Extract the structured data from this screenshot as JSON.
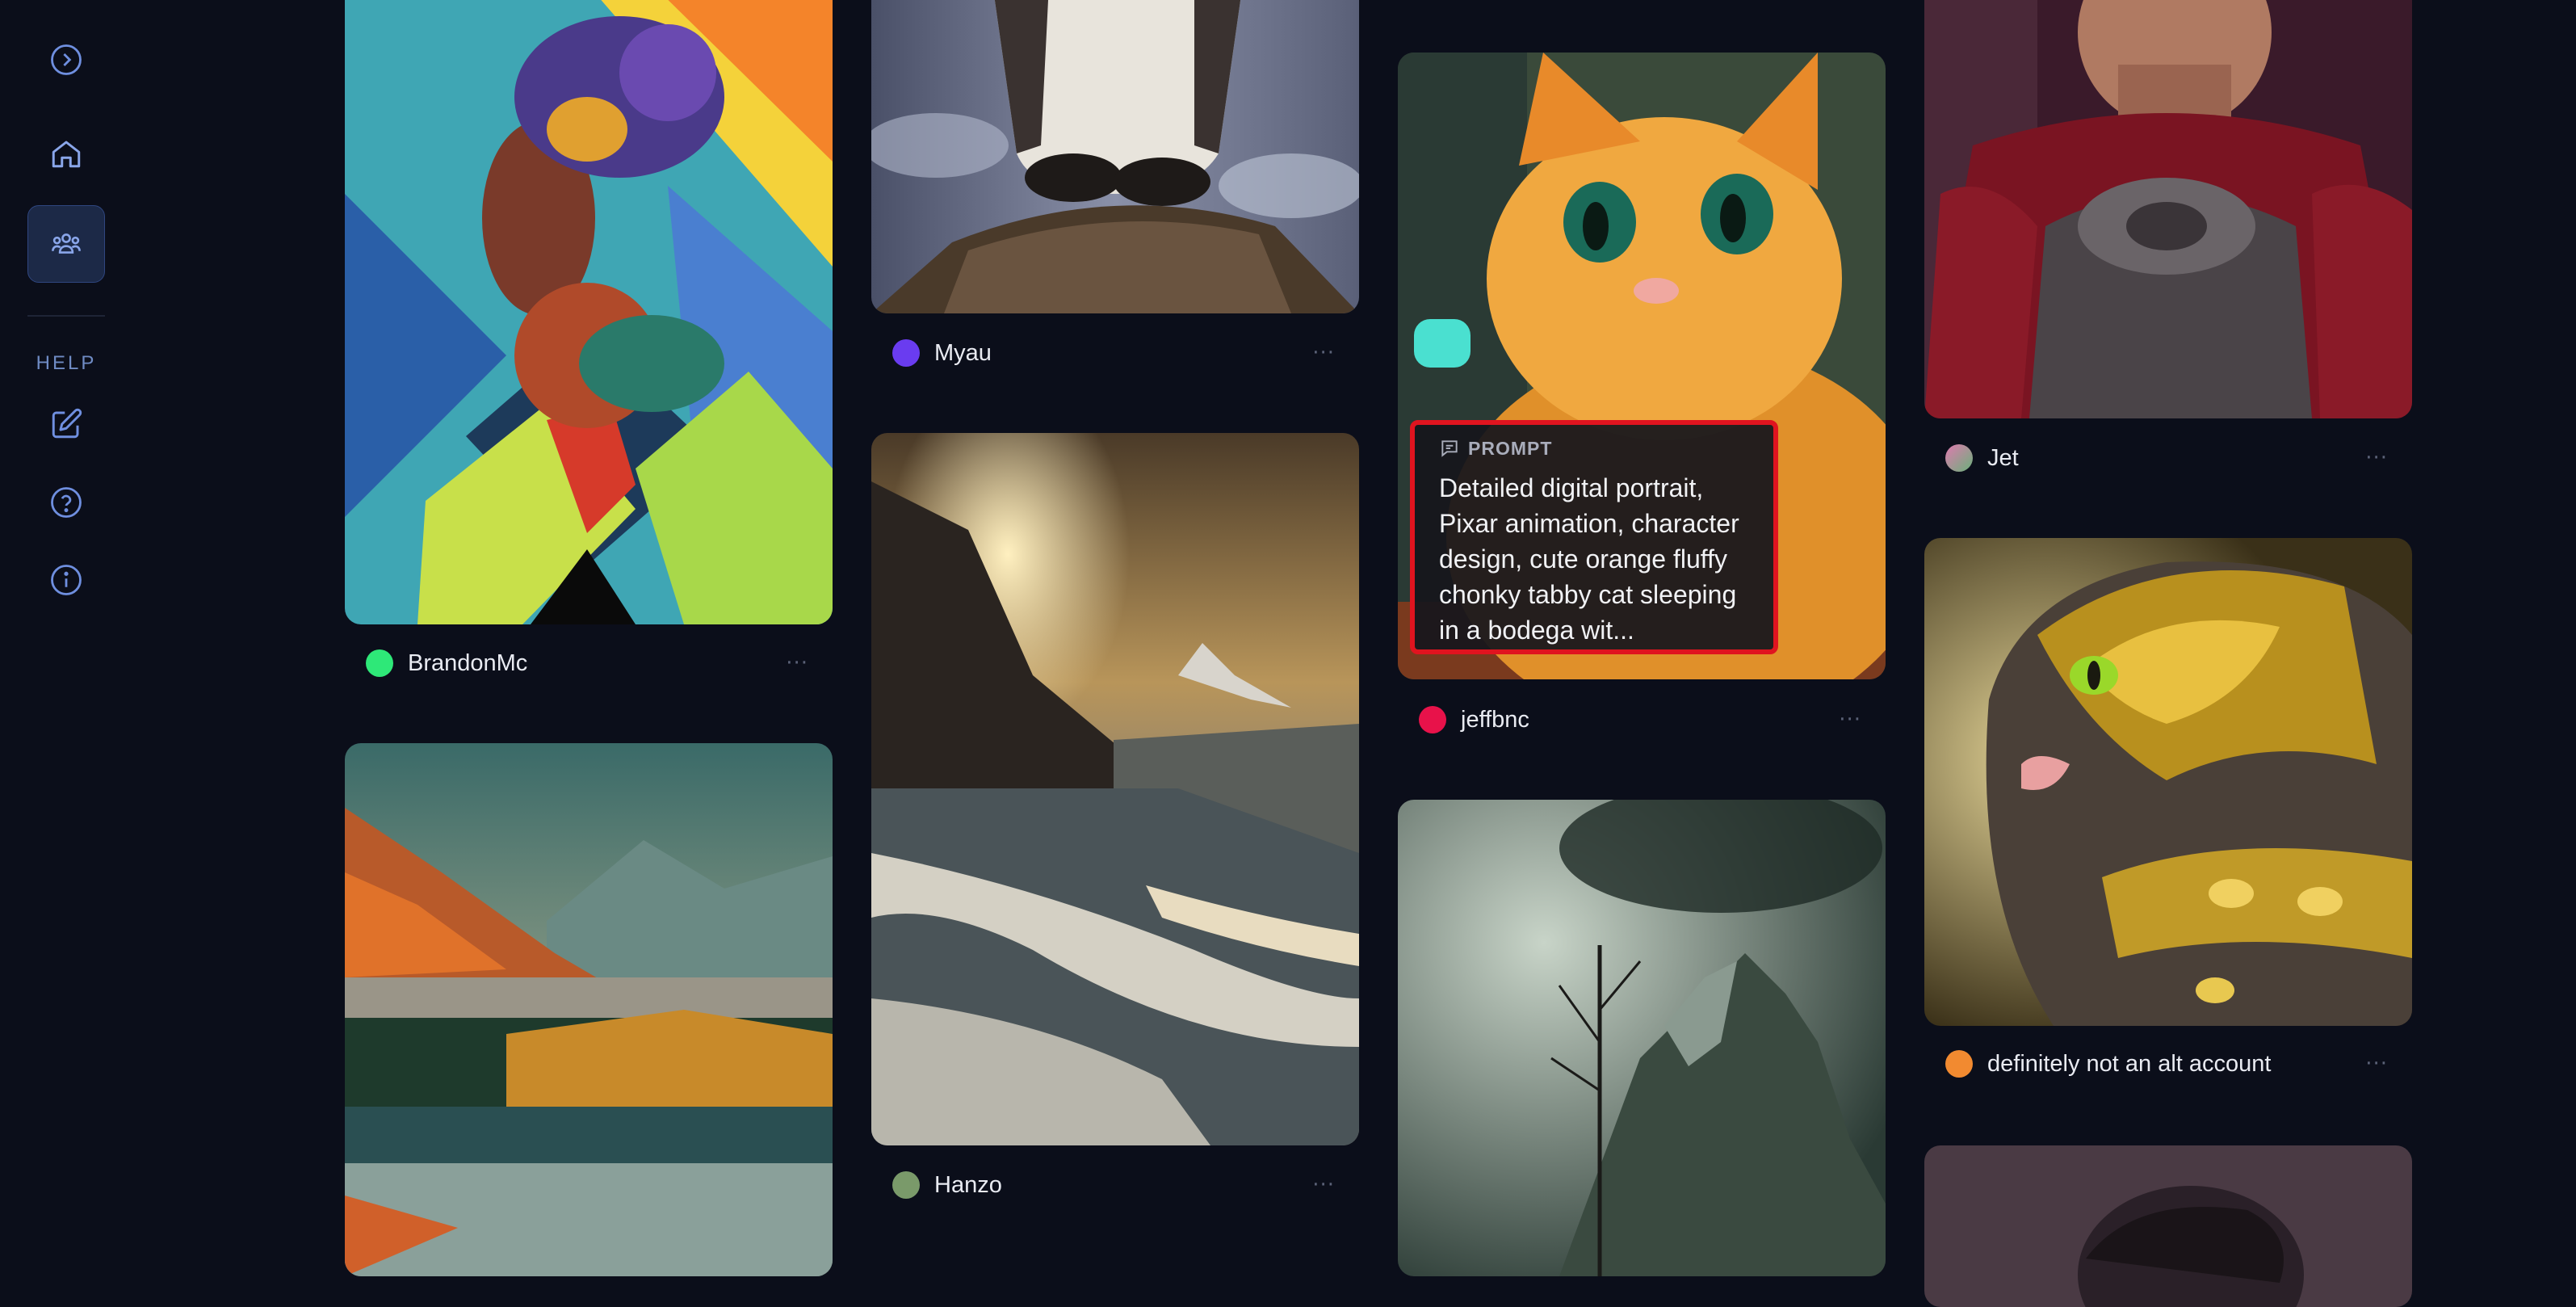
{
  "sidebar": {
    "help_label": "HELP",
    "items": [
      {
        "name": "expand-icon"
      },
      {
        "name": "home-icon"
      },
      {
        "name": "community-icon"
      },
      {
        "name": "edit-icon"
      },
      {
        "name": "help-circle-icon"
      },
      {
        "name": "info-icon"
      }
    ]
  },
  "prompt": {
    "label": "PROMPT",
    "text": "Detailed digital portrait, Pixar animation, character design, cute orange fluffy chonky tabby cat sleeping in a bodega wit..."
  },
  "cards": [
    {
      "user": "BrandonMc",
      "avatar_color": "#2ee878",
      "image": "abstract woman portrait with geometric diamonds"
    },
    {
      "user": "Myau",
      "avatar_color": "#6a3cf0",
      "image": "otter on rock"
    },
    {
      "user": "Hanzo",
      "avatar_color": "#7a9a6a",
      "image": "snowy mountain valley at sunset"
    },
    {
      "user": "jeffbnc",
      "avatar_color": "#e8124a",
      "image": "orange tabby cat"
    },
    {
      "user": "Jet",
      "avatar_color": "#c07aa0",
      "image": "warrior in red armor"
    },
    {
      "user": "definitely not an alt account",
      "avatar_color": "#f28a30",
      "image": "cat in golden armor"
    }
  ],
  "more_label": "···"
}
